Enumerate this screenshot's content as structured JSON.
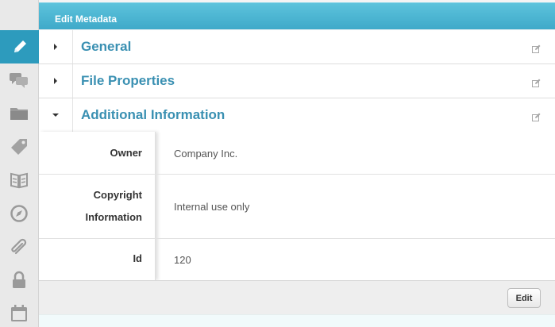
{
  "header": {
    "title": "Edit Metadata"
  },
  "rail": {
    "items": [
      {
        "icon": "pencil-icon",
        "active": true
      },
      {
        "icon": "comments-icon"
      },
      {
        "icon": "folder-icon"
      },
      {
        "icon": "tag-icon"
      },
      {
        "icon": "book-icon"
      },
      {
        "icon": "compass-icon"
      },
      {
        "icon": "paperclip-icon"
      },
      {
        "icon": "lock-icon"
      },
      {
        "icon": "calendar-icon"
      }
    ]
  },
  "sections": [
    {
      "label": "General",
      "expanded": false
    },
    {
      "label": "File Properties",
      "expanded": false
    },
    {
      "label": "Additional Information",
      "expanded": true
    }
  ],
  "details": {
    "owner_key": "Owner",
    "owner_value": "Company Inc.",
    "copyright_key_line1": "Copyright",
    "copyright_key_line2": "Information",
    "copyright_value": "Internal use only",
    "id_key": "Id",
    "id_value": "120"
  },
  "footer": {
    "edit_label": "Edit"
  },
  "colors": {
    "accent": "#2d9bbd",
    "section_label": "#3a90b2",
    "header_gradient_top": "#5cc3dc",
    "header_gradient_bottom": "#3fa9c9"
  }
}
